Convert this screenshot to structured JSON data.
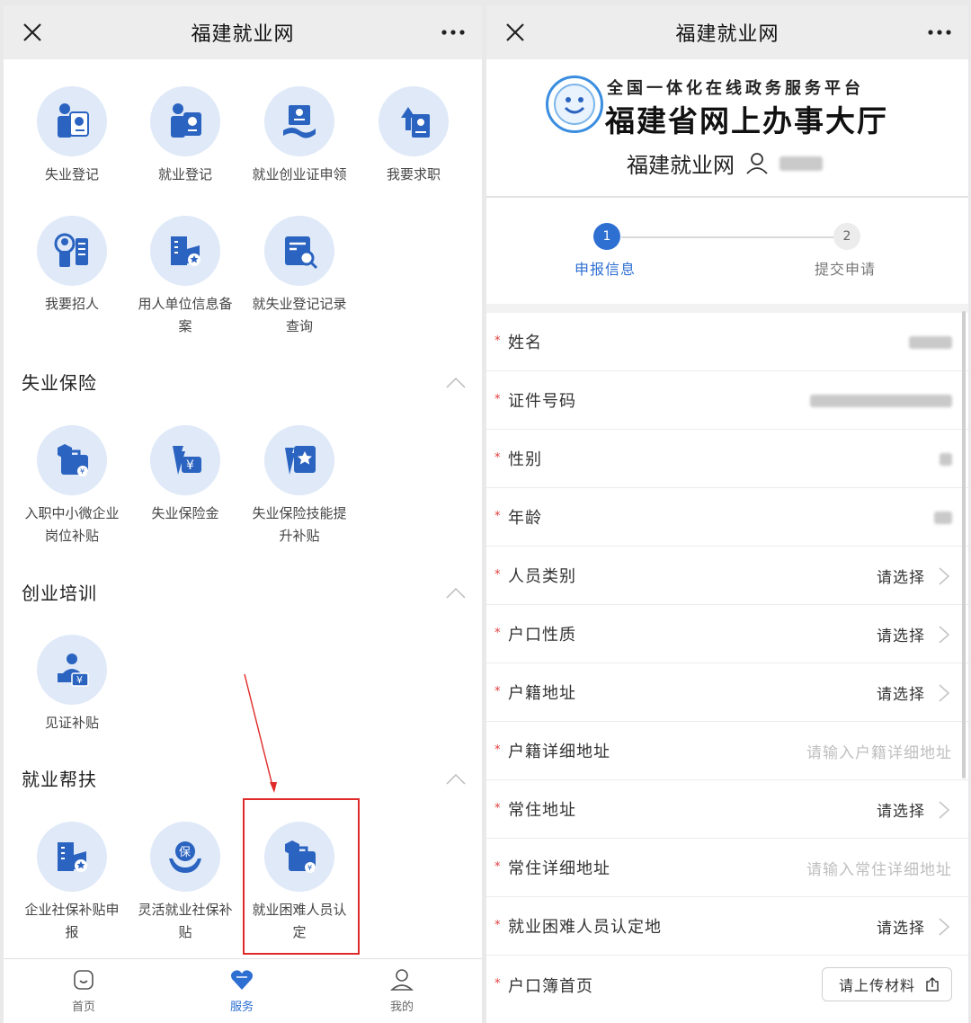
{
  "left": {
    "nav": {
      "title": "福建就业网"
    },
    "top_grid": [
      {
        "label": "失业登记",
        "icon": "unemployment-register-icon"
      },
      {
        "label": "就业登记",
        "icon": "employment-register-icon"
      },
      {
        "label": "就业创业证申领",
        "icon": "certificate-apply-icon"
      },
      {
        "label": "我要求职",
        "icon": "job-seek-icon"
      },
      {
        "label": "我要招人",
        "icon": "recruit-icon"
      },
      {
        "label": "用人单位信息备案",
        "icon": "employer-filing-icon"
      },
      {
        "label": "就失业登记记录查询",
        "icon": "record-query-icon"
      }
    ],
    "sections": [
      {
        "title": "失业保险",
        "items": [
          {
            "label": "入职中小微企业岗位补贴",
            "icon": "sme-subsidy-icon"
          },
          {
            "label": "失业保险金",
            "icon": "insurance-money-icon"
          },
          {
            "label": "失业保险技能提升补贴",
            "icon": "skill-subsidy-icon"
          }
        ]
      },
      {
        "title": "创业培训",
        "items": [
          {
            "label": "见证补贴",
            "icon": "witness-subsidy-icon"
          }
        ]
      },
      {
        "title": "就业帮扶",
        "items": [
          {
            "label": "企业社保补贴申报",
            "icon": "enterprise-social-icon"
          },
          {
            "label": "灵活就业社保补贴",
            "icon": "flexible-social-icon"
          },
          {
            "label": "就业困难人员认定",
            "icon": "difficulty-recognition-icon"
          }
        ]
      }
    ],
    "tabbar": [
      {
        "label": "首页",
        "icon": "home-icon"
      },
      {
        "label": "服务",
        "icon": "service-heart-icon",
        "active": true
      },
      {
        "label": "我的",
        "icon": "user-icon"
      }
    ]
  },
  "right": {
    "nav": {
      "title": "福建就业网"
    },
    "banner": {
      "platform_line1": "全国一体化在线政务服务平台",
      "platform_line2": "福建省网上办事大厅",
      "site_name": "福建就业网"
    },
    "steps": [
      {
        "num": "1",
        "label": "申报信息",
        "active": true
      },
      {
        "num": "2",
        "label": "提交申请",
        "active": false
      }
    ],
    "form": [
      {
        "label": "姓名",
        "type": "blurred"
      },
      {
        "label": "证件号码",
        "type": "blurred"
      },
      {
        "label": "性别",
        "type": "blurred"
      },
      {
        "label": "年龄",
        "type": "blurred"
      },
      {
        "label": "人员类别",
        "type": "select",
        "value": "请选择"
      },
      {
        "label": "户口性质",
        "type": "select",
        "value": "请选择"
      },
      {
        "label": "户籍地址",
        "type": "select",
        "value": "请选择"
      },
      {
        "label": "户籍详细地址",
        "type": "input",
        "placeholder": "请输入户籍详细地址"
      },
      {
        "label": "常住地址",
        "type": "select",
        "value": "请选择"
      },
      {
        "label": "常住详细地址",
        "type": "input",
        "placeholder": "请输入常住详细地址"
      },
      {
        "label": "就业困难人员认定地",
        "type": "select",
        "value": "请选择"
      },
      {
        "label": "户口簿首页",
        "type": "upload",
        "value": "请上传材料"
      }
    ]
  },
  "colors": {
    "accent": "#2e6fd2",
    "icon_bg": "#dfe9f8",
    "icon_fg": "#2a63c0",
    "required": "#e23a3a",
    "highlight": "#e02a2a"
  }
}
